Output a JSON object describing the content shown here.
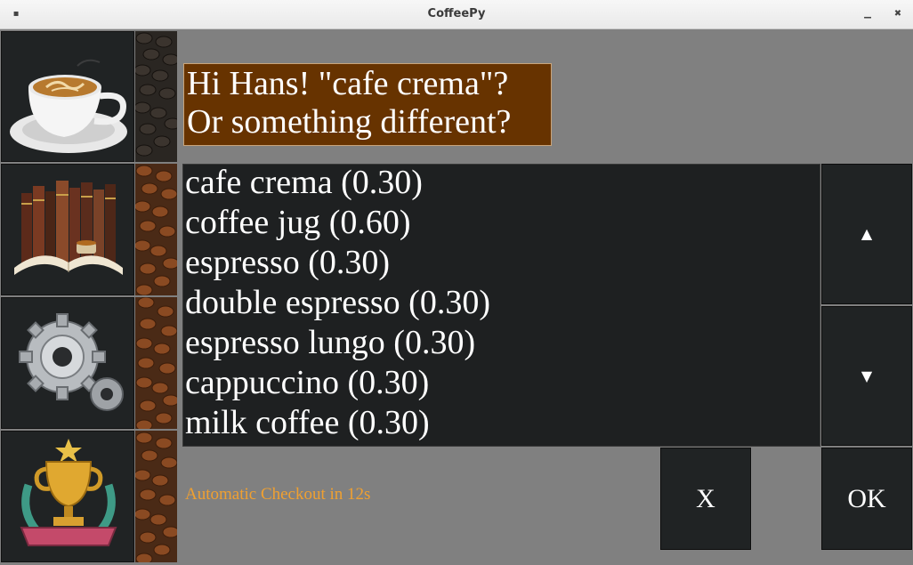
{
  "window": {
    "title": "CoffeePy",
    "menu_glyph": "▪",
    "minimize_glyph": "▁",
    "close_glyph": "✖"
  },
  "sidebar": {
    "items": [
      {
        "icon": "coffee-cup-icon"
      },
      {
        "icon": "books-icon"
      },
      {
        "icon": "gears-icon"
      },
      {
        "icon": "trophy-icon"
      }
    ]
  },
  "greeting": {
    "line1": "Hi Hans! \"cafe crema\"?",
    "line2": "Or something different?"
  },
  "products": [
    "cafe crema (0.30)",
    "coffee jug (0.60)",
    "espresso (0.30)",
    "double espresso (0.30)",
    "espresso lungo (0.30)",
    "cappuccino (0.30)",
    "milk coffee (0.30)"
  ],
  "scroll": {
    "up_label": "▲",
    "down_label": "▼"
  },
  "actions": {
    "cancel_label": "X",
    "ok_label": "OK"
  },
  "checkout_text": "Automatic Checkout in 12s",
  "colors": {
    "background": "#808080",
    "greeting_bg": "#673300",
    "checkout_text": "#f0a030",
    "panel_dark": "#202324"
  }
}
